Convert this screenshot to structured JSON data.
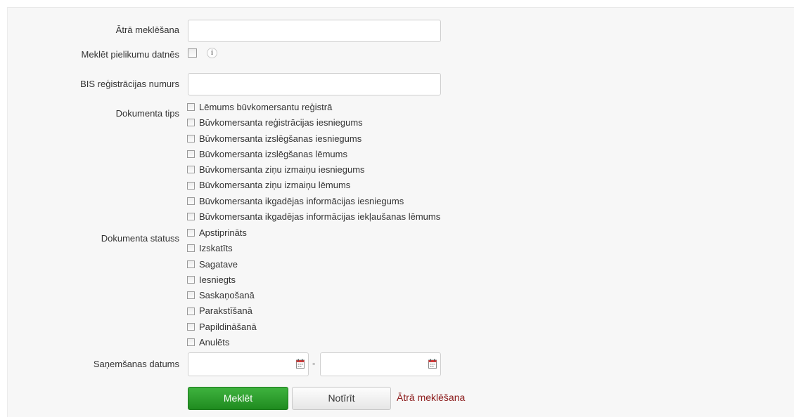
{
  "form": {
    "quick_search": {
      "label": "Ātrā meklēšana",
      "value": "",
      "placeholder": ""
    },
    "search_attachments": {
      "label": "Meklēt pielikumu datnēs",
      "checked": false,
      "info_icon": "info-icon"
    },
    "bis_number": {
      "label": "BIS reģistrācijas numurs",
      "value": "",
      "placeholder": ""
    },
    "document_type": {
      "label": "Dokumenta tips",
      "options": [
        "Lēmums būvkomersantu reģistrā",
        "Būvkomersanta reģistrācijas iesniegums",
        "Būvkomersanta izslēgšanas iesniegums",
        "Būvkomersanta izslēgšanas lēmums",
        "Būvkomersanta ziņu izmaiņu iesniegums",
        "Būvkomersanta ziņu izmaiņu lēmums",
        "Būvkomersanta ikgadējas informācijas iesniegums",
        "Būvkomersanta ikgadējas informācijas iekļaušanas lēmums"
      ]
    },
    "document_status": {
      "label": "Dokumenta statuss",
      "options": [
        "Apstiprināts",
        "Izskatīts",
        "Sagatave",
        "Iesniegts",
        "Saskaņošanā",
        "Parakstīšanā",
        "Papildināšanā",
        "Anulēts"
      ]
    },
    "received_date": {
      "label": "Saņemšanas datums",
      "from_value": "",
      "to_value": "",
      "separator": "-",
      "calendar_icon": "calendar-icon"
    }
  },
  "actions": {
    "search_label": "Meklēt",
    "clear_label": "Notīrīt",
    "quick_search_link": "Ātrā meklēšana"
  },
  "colors": {
    "primary_button": "#2a9d2a",
    "link": "#8b1a1a"
  }
}
